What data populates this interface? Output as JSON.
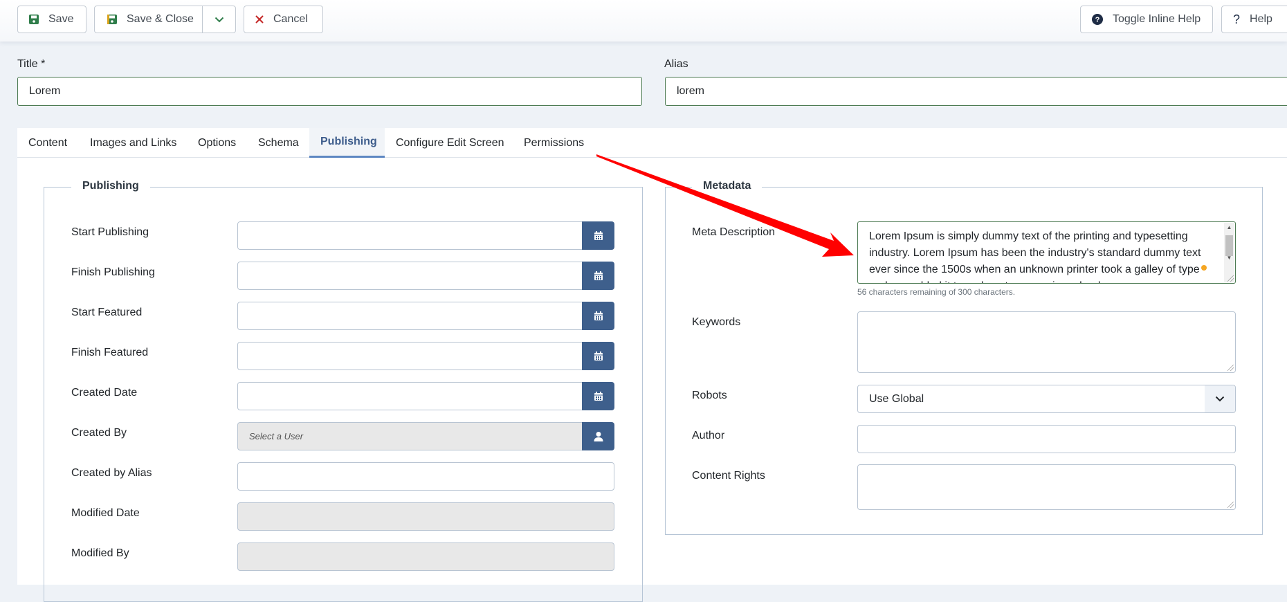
{
  "toolbar": {
    "save_label": "Save",
    "save_close_label": "Save & Close",
    "cancel_label": "Cancel",
    "toggle_help_label": "Toggle Inline Help",
    "help_label": "Help",
    "help_icon_glyph": "?"
  },
  "header": {
    "title_label": "Title *",
    "title_value": "Lorem",
    "alias_label": "Alias",
    "alias_value": "lorem"
  },
  "tabs": [
    {
      "label": "Content",
      "active": false
    },
    {
      "label": "Images and Links",
      "active": false
    },
    {
      "label": "Options",
      "active": false
    },
    {
      "label": "Schema",
      "active": false
    },
    {
      "label": "Publishing",
      "active": true
    },
    {
      "label": "Configure Edit Screen",
      "active": false
    },
    {
      "label": "Permissions",
      "active": false
    }
  ],
  "publishing": {
    "legend": "Publishing",
    "fields": [
      {
        "label": "Start Publishing",
        "value": "",
        "button": "calendar-icon"
      },
      {
        "label": "Finish Publishing",
        "value": "",
        "button": "calendar-icon"
      },
      {
        "label": "Start Featured",
        "value": "",
        "button": "calendar-icon"
      },
      {
        "label": "Finish Featured",
        "value": "",
        "button": "calendar-icon"
      },
      {
        "label": "Created Date",
        "value": "",
        "button": "calendar-icon"
      },
      {
        "label": "Created By",
        "value": "",
        "placeholder": "Select a User",
        "button": "user-icon"
      },
      {
        "label": "Created by Alias",
        "value": ""
      },
      {
        "label": "Modified Date",
        "value": "",
        "disabled": true
      },
      {
        "label": "Modified By",
        "value": "",
        "disabled": true
      }
    ]
  },
  "metadata": {
    "legend": "Metadata",
    "meta_description_label": "Meta Description",
    "meta_description_lines": [
      "Lorem Ipsum is simply dummy text of the printing and typesetting",
      "industry. Lorem Ipsum has been the industry's standard dummy text",
      "ever since the 1500s when an unknown printer took a galley of type",
      "and scrambled it to make a type specimen book."
    ],
    "char_count_text": "56 characters remaining of 300 characters.",
    "keywords_label": "Keywords",
    "keywords_value": "",
    "robots_label": "Robots",
    "robots_value": "Use Global",
    "author_label": "Author",
    "author_value": "",
    "content_rights_label": "Content Rights",
    "content_rights_value": ""
  },
  "colors": {
    "save_icon": "#2f7d4a",
    "cancel_icon": "#c52827",
    "accent": "#3e5f8c",
    "active_tab_border": "#5d87c2",
    "valid_border": "#4c7a52",
    "annotation_arrow": "#ff0000"
  }
}
